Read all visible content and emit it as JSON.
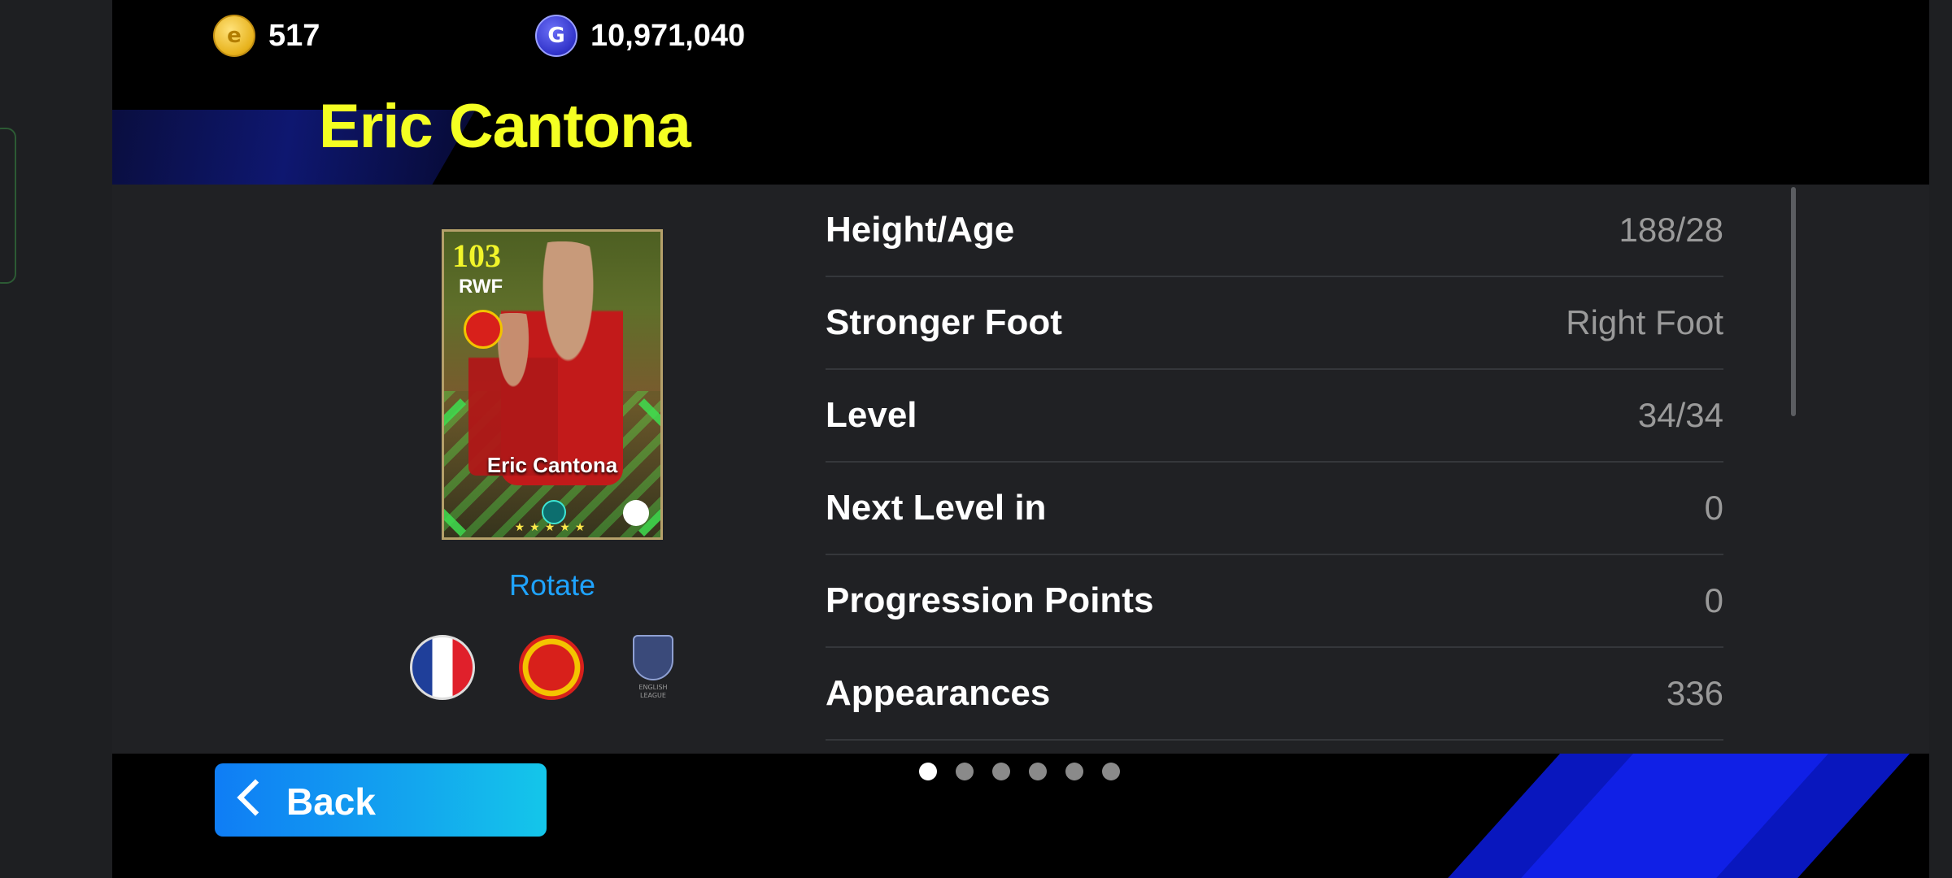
{
  "currency": {
    "ecoins": "517",
    "gp": "10,971,040",
    "ecoin_symbol": "e",
    "gp_symbol": "G"
  },
  "player": {
    "name": "Eric Cantona",
    "card": {
      "rating": "103",
      "position": "RWF",
      "name": "Eric Cantona",
      "stars": "★★★★★"
    },
    "rotate_label": "Rotate",
    "nationality_flag": "france-flag-icon",
    "club_crest": "manchester-united-crest-icon",
    "league_badge": "english-league-icon",
    "league_caption": "ENGLISH LEAGUE"
  },
  "info_rows": [
    {
      "label": "Height/Age",
      "value": "188/28"
    },
    {
      "label": "Stronger Foot",
      "value": "Right Foot"
    },
    {
      "label": "Level",
      "value": "34/34"
    },
    {
      "label": "Next Level in",
      "value": "0"
    },
    {
      "label": "Progression Points",
      "value": "0"
    },
    {
      "label": "Appearances",
      "value": "336"
    }
  ],
  "pagination": {
    "total": 6,
    "active_index": 0
  },
  "back_button": {
    "label": "Back"
  },
  "colors": {
    "title": "#f4ff22",
    "accent_blue": "#1fa3ff",
    "back_gradient_start": "#0f7df5",
    "back_gradient_end": "#14c6ea",
    "panel": "#202124"
  }
}
